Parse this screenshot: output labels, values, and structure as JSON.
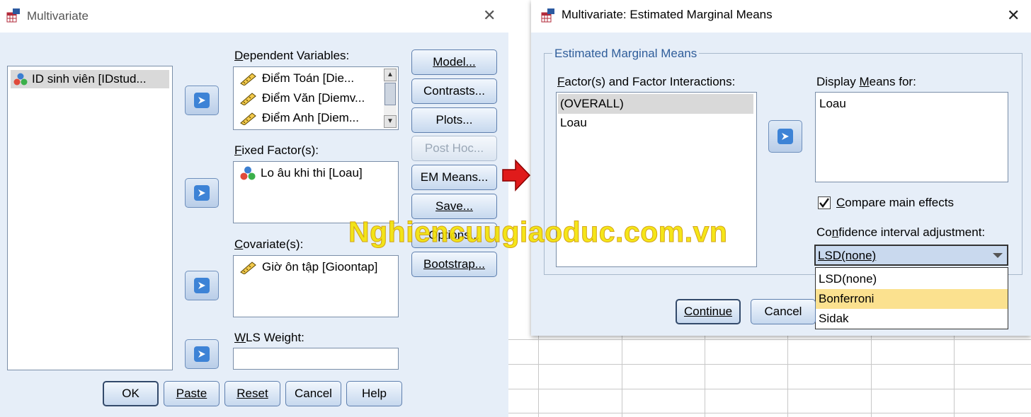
{
  "left_dialog": {
    "title": "Multivariate",
    "source_list": [
      "ID sinh viên [IDstud..."
    ],
    "dependent": {
      "label_u": "D",
      "label_rest": "ependent Variables:",
      "items": [
        "Điểm Toán [Die...",
        "Điểm Văn [Diemv...",
        "Điểm Anh [Diem..."
      ]
    },
    "fixed": {
      "label_u": "F",
      "label_rest": "ixed Factor(s):",
      "items": [
        "Lo âu khi thi [Loau]"
      ]
    },
    "covariate": {
      "label_u": "C",
      "label_rest": "ovariate(s):",
      "items": [
        "Giờ ôn tập [Gioontap]"
      ]
    },
    "wls": {
      "label_u": "W",
      "label_rest": "LS Weight:",
      "value": ""
    },
    "side_buttons": {
      "model": "Model...",
      "contrasts": "Contrasts...",
      "plots": "Plots...",
      "posthoc": "Post Hoc...",
      "em_means": "EM Means...",
      "save": "Save...",
      "options": "Options...",
      "bootstrap": "Bootstrap..."
    },
    "bottom_buttons": {
      "ok": "OK",
      "paste": "Paste",
      "reset": "Reset",
      "cancel": "Cancel",
      "help": "Help"
    }
  },
  "right_dialog": {
    "title": "Multivariate: Estimated Marginal Means",
    "group_title": "Estimated Marginal Means",
    "factors": {
      "label_u": "F",
      "label_rest": "actor(s) and Factor Interactions:",
      "items": [
        "(OVERALL)",
        "Loau"
      ]
    },
    "display": {
      "label_pre": "Display ",
      "label_u": "M",
      "label_rest": "eans for:",
      "items": [
        "Loau"
      ]
    },
    "compare": {
      "label_u": "C",
      "label_rest": "ompare main effects",
      "checked": true
    },
    "ci": {
      "label_pre": "Co",
      "label_u": "n",
      "label_rest": "fidence interval adjustment:",
      "selected": "LSD(none)",
      "options": [
        "LSD(none)",
        "Bonferroni",
        "Sidak"
      ],
      "highlighted": "Bonferroni"
    },
    "buttons": {
      "continue": "Continue",
      "cancel": "Cancel"
    }
  },
  "watermark": "Nghiencuugiaoduc.com.vn",
  "colors": {
    "dialog_bg": "#e6eef8",
    "highlight": "#fbe18f",
    "accent_arrow": "#3d83d6",
    "red_arrow": "#e01b1b"
  }
}
